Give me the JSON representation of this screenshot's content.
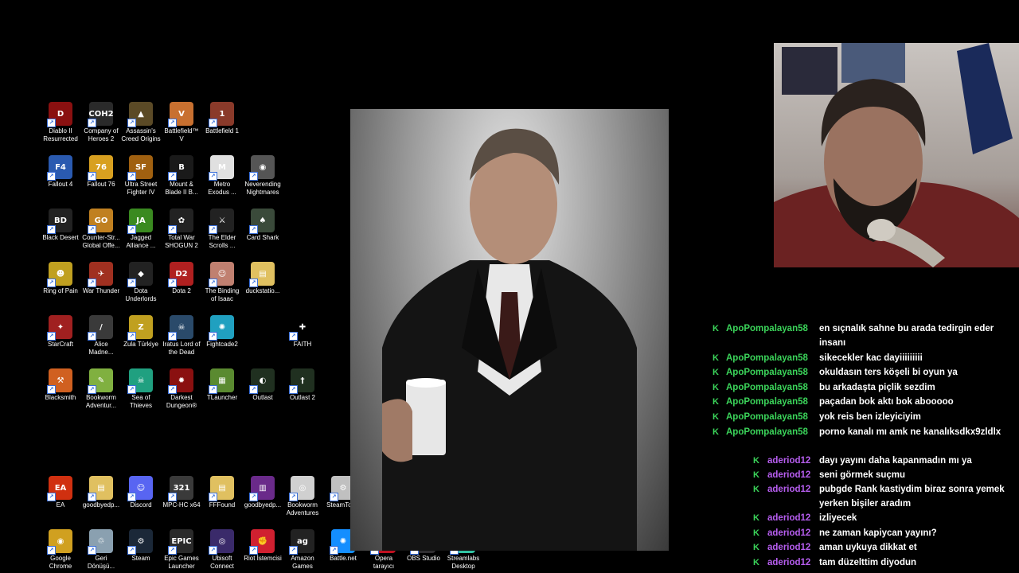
{
  "desktop_icons": [
    {
      "label": "Diablo II\nResurrected",
      "glyph": "D",
      "color": "#8a1010"
    },
    {
      "label": "Company of\nHeroes 2",
      "glyph": "COH2",
      "color": "#2a2a2a"
    },
    {
      "label": "Assassin's\nCreed Origins",
      "glyph": "▲",
      "color": "#5b4a26"
    },
    {
      "label": "Battlefield™ V",
      "glyph": "V",
      "color": "#c87030"
    },
    {
      "label": "Battlefield 1",
      "glyph": "1",
      "color": "#8a3a2a"
    },
    {
      "label": "Fallout 4",
      "glyph": "F4",
      "color": "#2a5ab0"
    },
    {
      "label": "Fallout 76",
      "glyph": "76",
      "color": "#d8a020"
    },
    {
      "label": "Ultra Street\nFighter IV",
      "glyph": "SF",
      "color": "#a06010"
    },
    {
      "label": "Mount &\nBlade II B...",
      "glyph": "B",
      "color": "#1a1a1a"
    },
    {
      "label": "Metro\nExodus ...",
      "glyph": "M",
      "color": "#e0e0e0"
    },
    {
      "label": "Neverending\nNightmares",
      "glyph": "◉",
      "color": "#555"
    },
    {
      "label": "Black Desert",
      "glyph": "BD",
      "color": "#222"
    },
    {
      "label": "Counter-Str...\nGlobal Offe...",
      "glyph": "GO",
      "color": "#c08020"
    },
    {
      "label": "Jagged\nAlliance ...",
      "glyph": "JA",
      "color": "#3a8a20"
    },
    {
      "label": "Total War\nSHOGUN 2",
      "glyph": "✿",
      "color": "#222"
    },
    {
      "label": "The Elder\nScrolls ...",
      "glyph": "⚔",
      "color": "#222"
    },
    {
      "label": "Card Shark",
      "glyph": "♠",
      "color": "#3a4a3a"
    },
    {
      "label": "Ring of Pain",
      "glyph": "☻",
      "color": "#c0a020"
    },
    {
      "label": "War Thunder",
      "glyph": "✈",
      "color": "#a03020"
    },
    {
      "label": "Dota\nUnderlords",
      "glyph": "◆",
      "color": "#222"
    },
    {
      "label": "Dota 2",
      "glyph": "D2",
      "color": "#b02020"
    },
    {
      "label": "The Binding\nof Isaac",
      "glyph": "☺",
      "color": "#c08070"
    },
    {
      "label": "duckstatio...",
      "glyph": "▤",
      "color": "#e0c060"
    },
    {
      "label": "StarCraft",
      "glyph": "✦",
      "color": "#a02020"
    },
    {
      "label": "Alice\nMadne...",
      "glyph": "/",
      "color": "#3a3a3a"
    },
    {
      "label": "Zula Türkiye",
      "glyph": "Z",
      "color": "#c0a020"
    },
    {
      "label": "Iratus Lord of\nthe Dead",
      "glyph": "☠",
      "color": "#2a4a6a"
    },
    {
      "label": "Fightcade2",
      "glyph": "✺",
      "color": "#20a0c0"
    },
    {
      "label": "FAITH",
      "glyph": "✚",
      "color": "#000"
    },
    {
      "label": "Blacksmith",
      "glyph": "⚒",
      "color": "#d06020"
    },
    {
      "label": "Bookworm\nAdventur...",
      "glyph": "✎",
      "color": "#80b040"
    },
    {
      "label": "Sea of\nThieves",
      "glyph": "☠",
      "color": "#20a080"
    },
    {
      "label": "Darkest\nDungeon®",
      "glyph": "✹",
      "color": "#8a1010"
    },
    {
      "label": "TLauncher",
      "glyph": "▦",
      "color": "#5a8a30"
    },
    {
      "label": "Outlast",
      "glyph": "◐",
      "color": "#203020"
    },
    {
      "label": "Outlast 2",
      "glyph": "†",
      "color": "#203020"
    },
    {
      "label": "EA",
      "glyph": "EA",
      "color": "#d03010"
    },
    {
      "label": "goodbyedp...",
      "glyph": "▤",
      "color": "#e0c060"
    },
    {
      "label": "Discord",
      "glyph": "☺",
      "color": "#5865f2"
    },
    {
      "label": "MPC-HC x64",
      "glyph": "321",
      "color": "#3a3a3a"
    },
    {
      "label": "FFFound",
      "glyph": "▤",
      "color": "#e0c060"
    },
    {
      "label": "goodbyedp...",
      "glyph": "▥",
      "color": "#6a2a8a"
    },
    {
      "label": "Bookworm\nAdventures",
      "glyph": "◎",
      "color": "#d0d0d0"
    },
    {
      "label": "SteamTools",
      "glyph": "⚙",
      "color": "#c0c0c0"
    },
    {
      "label": "Google\nChrome",
      "glyph": "◉",
      "color": "#d0a020"
    },
    {
      "label": "Geri\nDönüşü...",
      "glyph": "♲",
      "color": "#8aa0b0"
    },
    {
      "label": "Steam",
      "glyph": "⚙",
      "color": "#1b2838"
    },
    {
      "label": "Epic Games\nLauncher",
      "glyph": "EPIC",
      "color": "#2a2a2a"
    },
    {
      "label": "Ubisoft\nConnect",
      "glyph": "◎",
      "color": "#3a2a6a"
    },
    {
      "label": "Riot İstemcisi",
      "glyph": "✊",
      "color": "#d02030"
    },
    {
      "label": "Amazon\nGames",
      "glyph": "ag",
      "color": "#222"
    },
    {
      "label": "Battle.net",
      "glyph": "✺",
      "color": "#148eff"
    },
    {
      "label": "Opera\ntarayıcı",
      "glyph": "O",
      "color": "#c01020"
    },
    {
      "label": "OBS Studio",
      "glyph": "◍",
      "color": "#302e31"
    },
    {
      "label": "Streamlabs\nDesktop",
      "glyph": "▣",
      "color": "#31c3a2"
    }
  ],
  "chat": [
    {
      "indent": false,
      "user": "ApoPompalayan58",
      "text": "en sıçnalık sahne bu arada tedirgin eder insanı"
    },
    {
      "indent": false,
      "user": "ApoPompalayan58",
      "text": "sikecekler kac dayiiiiiiiii"
    },
    {
      "indent": false,
      "user": "ApoPompalayan58",
      "text": "okuldasın ters köşeli bi oyun ya"
    },
    {
      "indent": false,
      "user": "ApoPompalayan58",
      "text": "bu arkadaşta piçlik sezdim"
    },
    {
      "indent": false,
      "user": "ApoPompalayan58",
      "text": "paçadan bok aktı bok abooooo"
    },
    {
      "indent": false,
      "user": "ApoPompalayan58",
      "text": "yok reis ben izleyiciyim"
    },
    {
      "indent": false,
      "user": "ApoPompalayan58",
      "text": "porno kanalı mı amk ne kanalıksdkx9zldlx"
    },
    {
      "indent": true,
      "user": "aderiod12",
      "text": "dayı yayını daha kapanmadın mı ya"
    },
    {
      "indent": true,
      "user": "aderiod12",
      "text": "seni görmek suçmu"
    },
    {
      "indent": true,
      "user": "aderiod12",
      "text": "pubgde Rank kastiydim biraz sonra yemek yerken bişiler aradım"
    },
    {
      "indent": true,
      "user": "aderiod12",
      "text": "izliyecek"
    },
    {
      "indent": true,
      "user": "aderiod12",
      "text": "ne zaman kapiycan yayını?"
    },
    {
      "indent": true,
      "user": "aderiod12",
      "text": "aman uykuya dikkat et"
    },
    {
      "indent": true,
      "user": "aderiod12",
      "text": "tam düzelttim diyodun"
    }
  ],
  "chat_badge": "K",
  "colors": {
    "user_a": "#3bd45a",
    "user_b": "#b75ef0",
    "badge": "#3bd45a"
  }
}
